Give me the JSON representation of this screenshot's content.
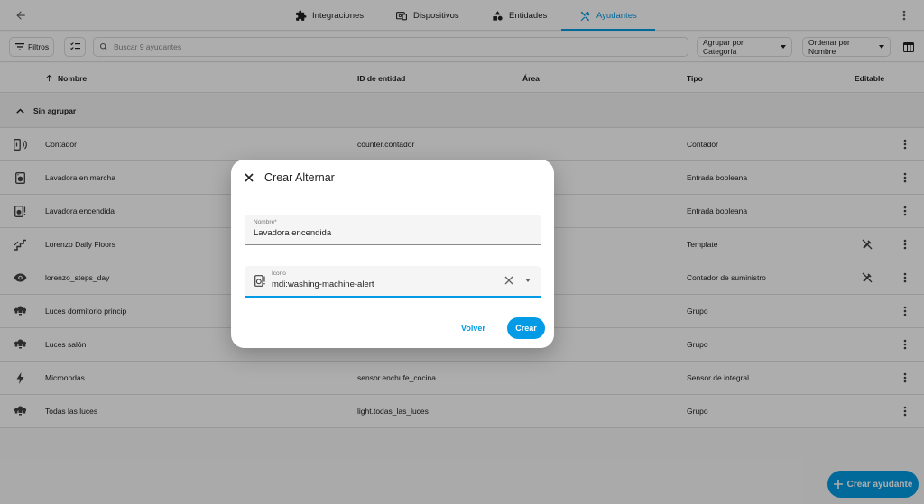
{
  "tabs": [
    {
      "label": "Integraciones",
      "icon": "puzzle-icon"
    },
    {
      "label": "Dispositivos",
      "icon": "devices-icon"
    },
    {
      "label": "Entidades",
      "icon": "shapes-icon"
    },
    {
      "label": "Ayudantes",
      "icon": "tools-icon",
      "active": true
    }
  ],
  "toolbar": {
    "filters_label": "Filtros",
    "search_placeholder": "Buscar 9 ayudantes",
    "group_by_label": "Agrupar por Categoría",
    "sort_by_label": "Ordenar por Nombre"
  },
  "table": {
    "columns": {
      "name": "Nombre",
      "entity_id": "ID de entidad",
      "area": "Área",
      "type": "Tipo",
      "editable": "Editable"
    },
    "group_label": "Sin agrupar",
    "rows": [
      {
        "name": "Contador",
        "entity_id": "counter.contador",
        "area": "",
        "type": "Contador",
        "icon": "counter-icon",
        "not_editable": false
      },
      {
        "name": "Lavadora en marcha",
        "entity_id": "",
        "area": "",
        "type": "Entrada booleana",
        "icon": "washing-machine-icon",
        "not_editable": false
      },
      {
        "name": "Lavadora encendida",
        "entity_id": "",
        "area": "",
        "type": "Entrada booleana",
        "icon": "washing-machine-alert-icon",
        "not_editable": false
      },
      {
        "name": "Lorenzo Daily Floors",
        "entity_id": "",
        "area": "",
        "type": "Template",
        "icon": "stairs-icon",
        "not_editable": true
      },
      {
        "name": "lorenzo_steps_day",
        "entity_id": "",
        "area": "",
        "type": "Contador de suministro",
        "icon": "eye-icon",
        "not_editable": true
      },
      {
        "name": "Luces dormitorio princip",
        "entity_id": "",
        "area": "",
        "type": "Grupo",
        "icon": "lightbulb-group-icon",
        "not_editable": false
      },
      {
        "name": "Luces salón",
        "entity_id": "",
        "area": "",
        "type": "Grupo",
        "icon": "lightbulb-group-icon",
        "not_editable": false
      },
      {
        "name": "Microondas",
        "entity_id": "sensor.enchufe_cocina",
        "area": "",
        "type": "Sensor de integral",
        "icon": "flash-icon",
        "not_editable": false
      },
      {
        "name": "Todas las luces",
        "entity_id": "light.todas_las_luces",
        "area": "",
        "type": "Grupo",
        "icon": "lightbulb-group-icon",
        "not_editable": false
      }
    ]
  },
  "fab": {
    "label": "Crear ayudante"
  },
  "dialog": {
    "title": "Crear Alternar",
    "name_label": "Nombre*",
    "name_value": "Lavadora encendida",
    "icon_label": "Icono",
    "icon_value": "mdi:washing-machine-alert",
    "cancel_label": "Volver",
    "create_label": "Crear"
  },
  "colors": {
    "accent": "#039be5",
    "background": "#fafafa",
    "divider": "#e0e0e0"
  }
}
